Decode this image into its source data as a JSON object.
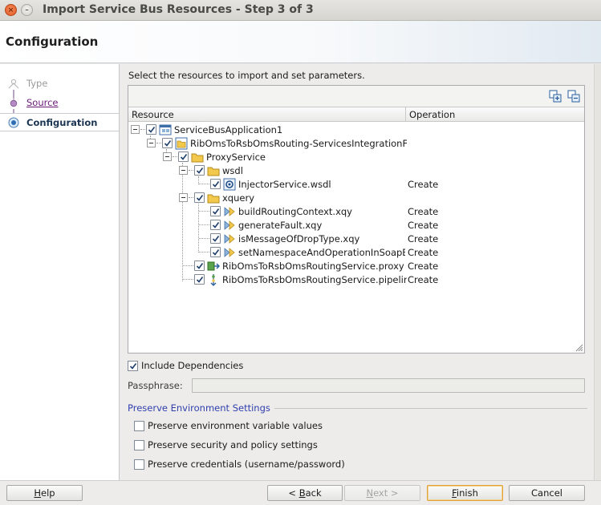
{
  "window": {
    "title": "Import Service Bus Resources - Step 3 of 3",
    "close_glyph": "×",
    "min_glyph": "–"
  },
  "header": {
    "title": "Configuration"
  },
  "nav": {
    "items": [
      {
        "label": "Type",
        "state": "disabled"
      },
      {
        "label": "Source",
        "state": "visited"
      },
      {
        "label": "Configuration",
        "state": "current"
      }
    ]
  },
  "main": {
    "instruction": "Select the resources to import and set parameters.",
    "columns": {
      "resource": "Resource",
      "operation": "Operation"
    },
    "tree": [
      {
        "label": "ServiceBusApplication1",
        "operation": "",
        "icon": "application-icon"
      },
      {
        "label": "RibOmsToRsbOmsRouting-ServicesIntegrationF",
        "operation": "",
        "icon": "project-folder-icon"
      },
      {
        "label": "ProxyService",
        "operation": "",
        "icon": "folder-icon"
      },
      {
        "label": "wsdl",
        "operation": "",
        "icon": "folder-icon"
      },
      {
        "label": "InjectorService.wsdl",
        "operation": "Create",
        "icon": "wsdl-icon"
      },
      {
        "label": "xquery",
        "operation": "",
        "icon": "folder-icon"
      },
      {
        "label": "buildRoutingContext.xqy",
        "operation": "Create",
        "icon": "xquery-icon"
      },
      {
        "label": "generateFault.xqy",
        "operation": "Create",
        "icon": "xquery-icon"
      },
      {
        "label": "isMessageOfDropType.xqy",
        "operation": "Create",
        "icon": "xquery-icon"
      },
      {
        "label": "setNamespaceAndOperationInSoapB",
        "operation": "Create",
        "icon": "xquery-icon"
      },
      {
        "label": "RibOmsToRsbOmsRoutingService.proxy",
        "operation": "Create",
        "icon": "proxy-service-icon"
      },
      {
        "label": "RibOmsToRsbOmsRoutingService.pipelir",
        "operation": "Create",
        "icon": "pipeline-icon"
      }
    ],
    "include_dependencies": {
      "label": "Include Dependencies",
      "checked": true
    },
    "passphrase": {
      "label": "Passphrase:",
      "value": ""
    },
    "preserve": {
      "title": "Preserve Environment Settings",
      "options": [
        {
          "label": "Preserve environment variable values",
          "checked": false
        },
        {
          "label": "Preserve security and policy settings",
          "checked": false
        },
        {
          "label": "Preserve credentials (username/password)",
          "checked": false
        }
      ]
    }
  },
  "footer": {
    "help": {
      "mnemonic": "H",
      "rest": "elp"
    },
    "back": {
      "prefix": "< ",
      "mnemonic": "B",
      "rest": "ack"
    },
    "next": {
      "mnemonic": "N",
      "rest": "ext >"
    },
    "finish": {
      "mnemonic": "F",
      "rest": "inish"
    },
    "cancel": {
      "label": "Cancel"
    }
  },
  "colors": {
    "accent": "#2f3fae",
    "visited_link": "#6d1a7a",
    "default_button_border": "#e0a23b",
    "folder": "#f2c94c"
  }
}
